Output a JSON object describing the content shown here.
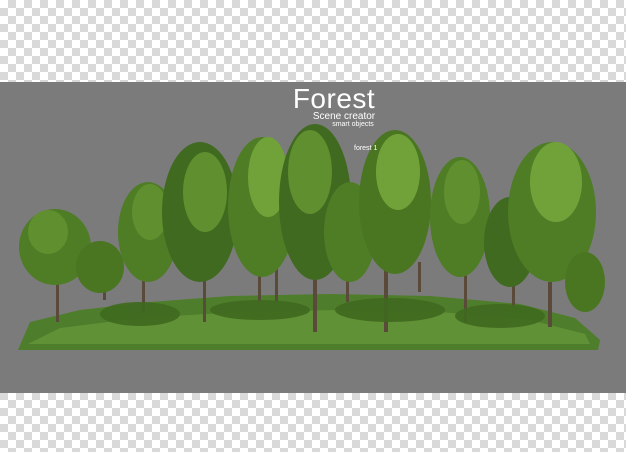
{
  "header": {
    "title": "Forest",
    "subtitle": "Scene creator",
    "tagline": "smart objects"
  },
  "scene": {
    "label": "forest 1",
    "background_color": "#7b7b7b",
    "foliage_colors": [
      "#3f6a1f",
      "#4f7d26",
      "#5f8f2f",
      "#71a23a"
    ],
    "grass_color": "#5a8a34",
    "trunk_color": "#5a4a3a"
  }
}
